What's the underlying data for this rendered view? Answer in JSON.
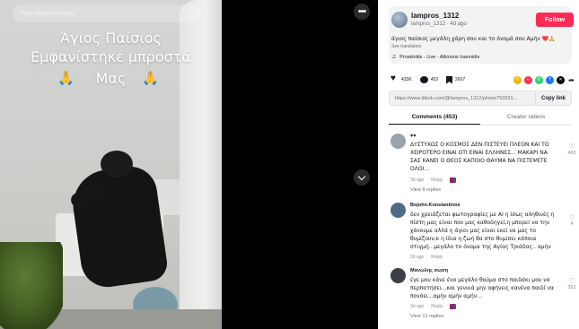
{
  "search": {
    "placeholder": "Find related content"
  },
  "overlay": {
    "line1": "Άγιος Παίσιος",
    "line2": "Εμφανίστηκε μπροστά",
    "line3": "Μας",
    "emoji": "🙏"
  },
  "controls": {
    "more": "•••"
  },
  "post": {
    "username": "lampros_1312",
    "handle": "lampros_1312",
    "age": "4d ago",
    "follow_label": "Follow",
    "caption": "άγιος παίσιος μεγάλη χάρη σου και το όνομά σου Αμήν ❤️🙏",
    "see_translation": "See translation",
    "music": "Proskinitis - Live - Alkinoos Ioannidis",
    "likes": "433K",
    "comments": "453",
    "saves": "2607",
    "link": "https://www.tiktok.com/@lampros_1312/photo/752631...",
    "copy_label": "Copy link"
  },
  "tabs": [
    {
      "label": "Comments (453)"
    },
    {
      "label": "Creator videos"
    }
  ],
  "comments": [
    {
      "user": "♥♥",
      "text": "ΔΥΣΤΥΧΩΣ Ο ΚΟΣΜΟΣ ΔΕΝ ΠΙΣΤΕΥΕΙ ΠΛΕΟΝ ΚΑΙ ΤΟ ΧΕΙΡΟΤΕΡΟ ΕΙΝΑΙ ΟΤΙ ΕΙΝΑΙ ΕΛΛΗΝΕΣ... ΜΑΚΑΡΙ ΝΑ ΣΑΣ ΚΑΝΕΙ Ο ΘΕΟΣ ΚΑΠΟΙΟ ΘΑΥΜΑ ΝΑ ΠΙΣΤΕΨΕΤΕ ΟΛΟΙ...",
      "date": "3d ago",
      "reply": "Reply",
      "likes": "463",
      "replies": "View 9 replies",
      "avatar_color": "#9aa3ad"
    },
    {
      "user": "Bojohn.Konstantinos",
      "text": "δεν χρειάζεται φωτογραφίες με AI η ίσως αληθινές η πίστη μας είναι που μας καθοδηγεί,η μπορεί να την χάνουμε αλλά η άγιοι μας είναι εκεί να μας το θυμίζουν,κ η ίδια η ζωή θα στο θυμίσει κάποια στιγμή...μεγάλο το όνομα της Αγίας Τριάδας.. αμήν",
      "date": "2d ago",
      "reply": "Reply",
      "likes": "4",
      "replies": "",
      "avatar_color": "#4f6b86"
    },
    {
      "user": "Μανώλης σωση",
      "text": "έγε μου κάνε ένα μεγάλο θαύμα στο παιδάκι μου να περπατήσει...και γενικά μην αφήνεις κανένα παιδί να πονάει...αμήν αμήν αμήν...",
      "date": "3d ago",
      "reply": "Reply",
      "likes": "362",
      "replies": "View 12 replies",
      "avatar_color": "#3b3f46"
    }
  ],
  "colors": {
    "follow": "#fe2c55",
    "text": "#161823",
    "muted": "#8a8b91"
  }
}
